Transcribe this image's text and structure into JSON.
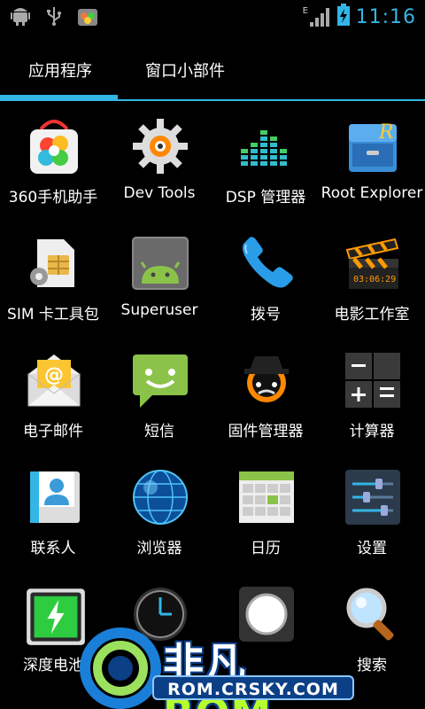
{
  "status_bar": {
    "time": "11:16",
    "network": "E",
    "icons": [
      "android-debug-icon",
      "usb-icon",
      "app-store-notification-icon",
      "signal-icon",
      "battery-charging-icon"
    ]
  },
  "tabs": [
    {
      "label": "应用程序",
      "selected": true
    },
    {
      "label": "窗口小部件",
      "selected": false
    }
  ],
  "accent_color": "#33b5e5",
  "apps": [
    {
      "label": "360手机助手",
      "icon": "360-assistant-icon"
    },
    {
      "label": "Dev Tools",
      "icon": "dev-tools-gear-icon"
    },
    {
      "label": "DSP 管理器",
      "icon": "equalizer-icon"
    },
    {
      "label": "Root Explorer",
      "icon": "file-cabinet-icon"
    },
    {
      "label": "SIM 卡工具包",
      "icon": "sim-card-icon"
    },
    {
      "label": "Superuser",
      "icon": "superuser-android-icon"
    },
    {
      "label": "拨号",
      "icon": "phone-icon"
    },
    {
      "label": "电影工作室",
      "icon": "clapperboard-icon"
    },
    {
      "label": "电子邮件",
      "icon": "email-envelope-icon"
    },
    {
      "label": "短信",
      "icon": "messaging-icon"
    },
    {
      "label": "固件管理器",
      "icon": "rom-manager-icon"
    },
    {
      "label": "计算器",
      "icon": "calculator-icon"
    },
    {
      "label": "联系人",
      "icon": "contacts-icon"
    },
    {
      "label": "浏览器",
      "icon": "browser-globe-icon"
    },
    {
      "label": "日历",
      "icon": "calendar-icon"
    },
    {
      "label": "设置",
      "icon": "settings-sliders-icon"
    },
    {
      "label": "深度电池",
      "icon": "battery-icon"
    },
    {
      "label": "",
      "icon": "clock-icon"
    },
    {
      "label": "",
      "icon": "flashlight-icon"
    },
    {
      "label": "搜索",
      "icon": "search-magnifier-icon"
    }
  ],
  "watermark": {
    "brand_part1": "非凡",
    "brand_part2": "ROM",
    "url": "ROM.CRSKY.COM"
  }
}
